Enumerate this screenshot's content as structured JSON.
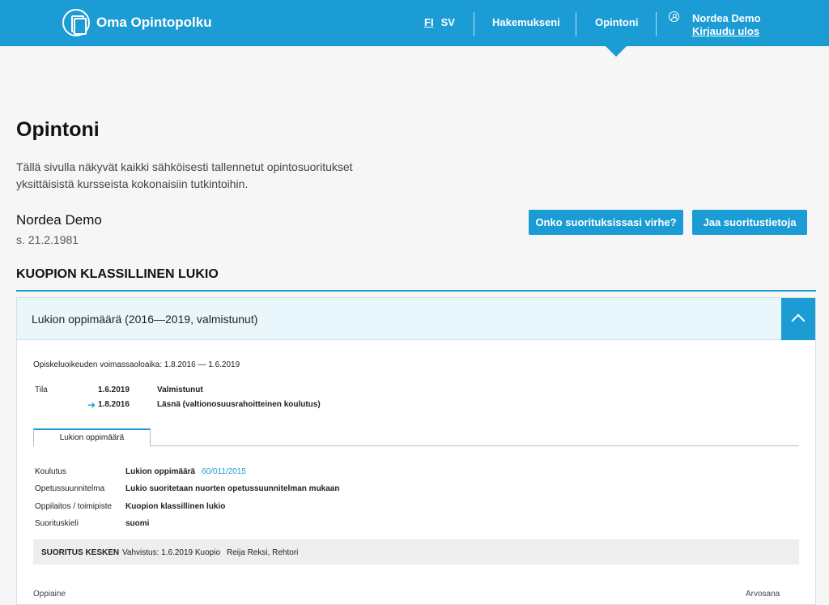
{
  "header": {
    "app_title": "Oma Opintopolku",
    "lang_fi": "FI",
    "lang_sv": "SV",
    "nav_applications": "Hakemukseni",
    "nav_studies": "Opintoni",
    "user_name": "Nordea Demo",
    "logout": "Kirjaudu ulos",
    "accent_color": "#1b9cd4"
  },
  "page": {
    "title": "Opintoni",
    "intro": "Tällä sivulla näkyvät kaikki sähköisesti tallennetut opintosuoritukset yksittäisistä kursseista kokonaisiin tutkintoihin.",
    "student_name": "Nordea Demo",
    "student_dob": "s. 21.2.1981",
    "btn_error": "Onko suorituksissasi virhe?",
    "btn_share": "Jaa suoritustietoja",
    "school_name": "KUOPION KLASSILLINEN LUKIO"
  },
  "card": {
    "heading": "Lukion oppimäärä (2016—2019, valmistunut)",
    "validity": "Opiskeluoikeuden voimassaoloaika: 1.8.2016 — 1.6.2019",
    "tila_label": "Tila",
    "states": [
      {
        "date": "1.6.2019",
        "value": "Valmistunut"
      },
      {
        "date": "1.8.2016",
        "value": "Läsnä (valtionosuusrahoitteinen koulutus)"
      }
    ],
    "tab_label": "Lukion oppimäärä",
    "info": [
      {
        "label": "Koulutus",
        "value": "Lukion oppimäärä",
        "extra": "60/011/2015"
      },
      {
        "label": "Opetussuunnitelma",
        "value": "Lukio suoritetaan nuorten opetussuunnitelman mukaan"
      },
      {
        "label": "Oppilaitos / toimipiste",
        "value": "Kuopion klassillinen lukio"
      },
      {
        "label": "Suorituskieli",
        "value": "suomi"
      }
    ],
    "status_label": "SUORITUS KESKEN",
    "confirmation": "Vahvistus: 1.6.2019 Kuopio",
    "signer": "Reija Reksi, Rehtori",
    "col_subject": "Oppiaine",
    "col_grade": "Arvosana"
  }
}
